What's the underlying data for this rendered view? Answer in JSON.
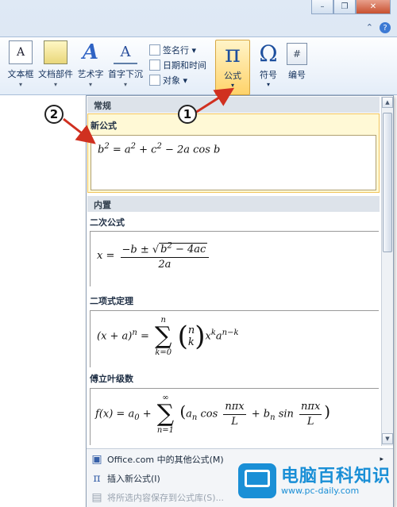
{
  "window": {
    "minimize": "–",
    "restore": "❐",
    "close": "✕"
  },
  "ribbon_ctrls": {
    "collapse": "⌃",
    "help": "?"
  },
  "ribbon": {
    "textbox": {
      "label": "文本框",
      "icon_glyph": "A"
    },
    "parts": {
      "label": "文档部件"
    },
    "wordart": {
      "label": "艺术字",
      "icon_glyph": "A"
    },
    "dropcap": {
      "label": "首字下沉",
      "icon_glyph": "A"
    },
    "signature": {
      "label": "签名行 ▾"
    },
    "datetime": {
      "label": "日期和时间"
    },
    "object": {
      "label": "对象 ▾"
    },
    "formula": {
      "label": "公式",
      "icon_glyph": "π"
    },
    "symbol": {
      "label": "符号",
      "icon_glyph": "Ω"
    },
    "number": {
      "label": "编号",
      "icon_glyph": "#"
    },
    "caret": "▾"
  },
  "gallery": {
    "section_general": "常规",
    "new_formula_title": "新公式",
    "section_builtin": "内置",
    "quadratic_title": "二次公式",
    "binomial_title": "二项式定理",
    "fourier_title": "傅立叶级数"
  },
  "menu": {
    "office_more": "Office.com 中的其他公式(M)",
    "insert_new": "插入新公式(I)",
    "save_selection": "将所选内容保存到公式库(S)...",
    "insert_new_icon": "π"
  },
  "callouts": {
    "one": "1",
    "two": "2"
  },
  "watermark": {
    "brand": "电脑百科知识",
    "url": "www.pc-daily.com"
  },
  "colors": {
    "accent_blue": "#1d4f9e",
    "highlight": "#ffd36a",
    "watermark": "#1a8fd6"
  }
}
